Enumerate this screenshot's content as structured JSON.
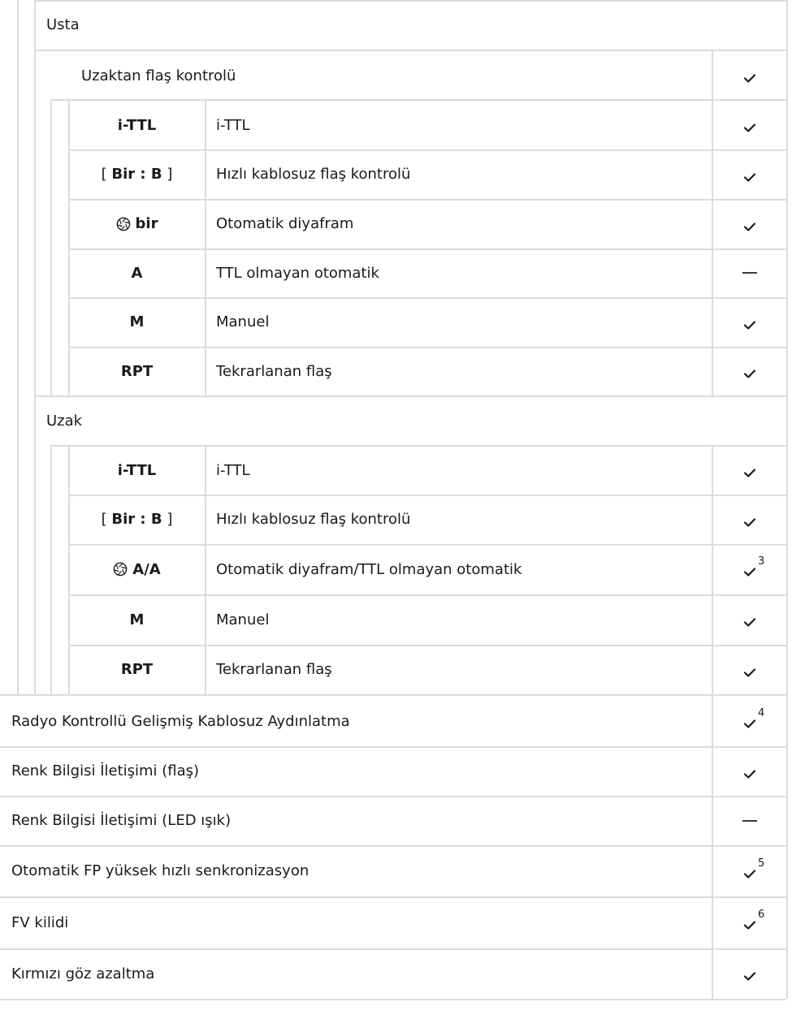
{
  "master": {
    "label": "Usta",
    "remote_flash_control": {
      "label": "Uzaktan flaş kontrolü",
      "support": "check"
    },
    "modes": [
      {
        "code": "i-TTL",
        "icon": "",
        "bracket": false,
        "desc": "i-TTL",
        "support": "check",
        "footnote": ""
      },
      {
        "code": "Bir : B",
        "icon": "",
        "bracket": true,
        "desc": "Hızlı kablosuz flaş kontrolü",
        "support": "check",
        "footnote": ""
      },
      {
        "code": "bir",
        "icon": "aperture-icon",
        "bracket": false,
        "desc": "Otomatik diyafram",
        "support": "check",
        "footnote": ""
      },
      {
        "code": "A",
        "icon": "",
        "bracket": false,
        "desc": "TTL olmayan otomatik",
        "support": "dash",
        "footnote": ""
      },
      {
        "code": "M",
        "icon": "",
        "bracket": false,
        "desc": "Manuel",
        "support": "check",
        "footnote": ""
      },
      {
        "code": "RPT",
        "icon": "",
        "bracket": false,
        "desc": "Tekrarlanan flaş",
        "support": "check",
        "footnote": ""
      }
    ]
  },
  "remote": {
    "label": "Uzak",
    "modes": [
      {
        "code": "i-TTL",
        "icon": "",
        "bracket": false,
        "desc": "i-TTL",
        "support": "check",
        "footnote": ""
      },
      {
        "code": "Bir : B",
        "icon": "",
        "bracket": true,
        "desc": "Hızlı kablosuz flaş kontrolü",
        "support": "check",
        "footnote": ""
      },
      {
        "code": "A/A",
        "icon": "aperture-icon",
        "bracket": false,
        "desc": "Otomatik diyafram/TTL olmayan otomatik",
        "support": "check",
        "footnote": "3"
      },
      {
        "code": "M",
        "icon": "",
        "bracket": false,
        "desc": "Manuel",
        "support": "check",
        "footnote": ""
      },
      {
        "code": "RPT",
        "icon": "",
        "bracket": false,
        "desc": "Tekrarlanan flaş",
        "support": "check",
        "footnote": ""
      }
    ]
  },
  "features": [
    {
      "label": "Radyo Kontrollü Gelişmiş Kablosuz Aydınlatma",
      "support": "check",
      "footnote": "4"
    },
    {
      "label": "Renk Bilgisi İletişimi (flaş)",
      "support": "check",
      "footnote": ""
    },
    {
      "label": "Renk Bilgisi İletişimi (LED ışık)",
      "support": "dash",
      "footnote": ""
    },
    {
      "label": "Otomatik FP yüksek hızlı senkronizasyon",
      "support": "check",
      "footnote": "5"
    },
    {
      "label": "FV kilidi",
      "support": "check",
      "footnote": "6"
    },
    {
      "label": "Kırmızı göz azaltma",
      "support": "check",
      "footnote": ""
    }
  ],
  "colors": {
    "rule": "#dcdcdc",
    "text": "#1a1a1a",
    "mark": "#1a1a1a"
  }
}
